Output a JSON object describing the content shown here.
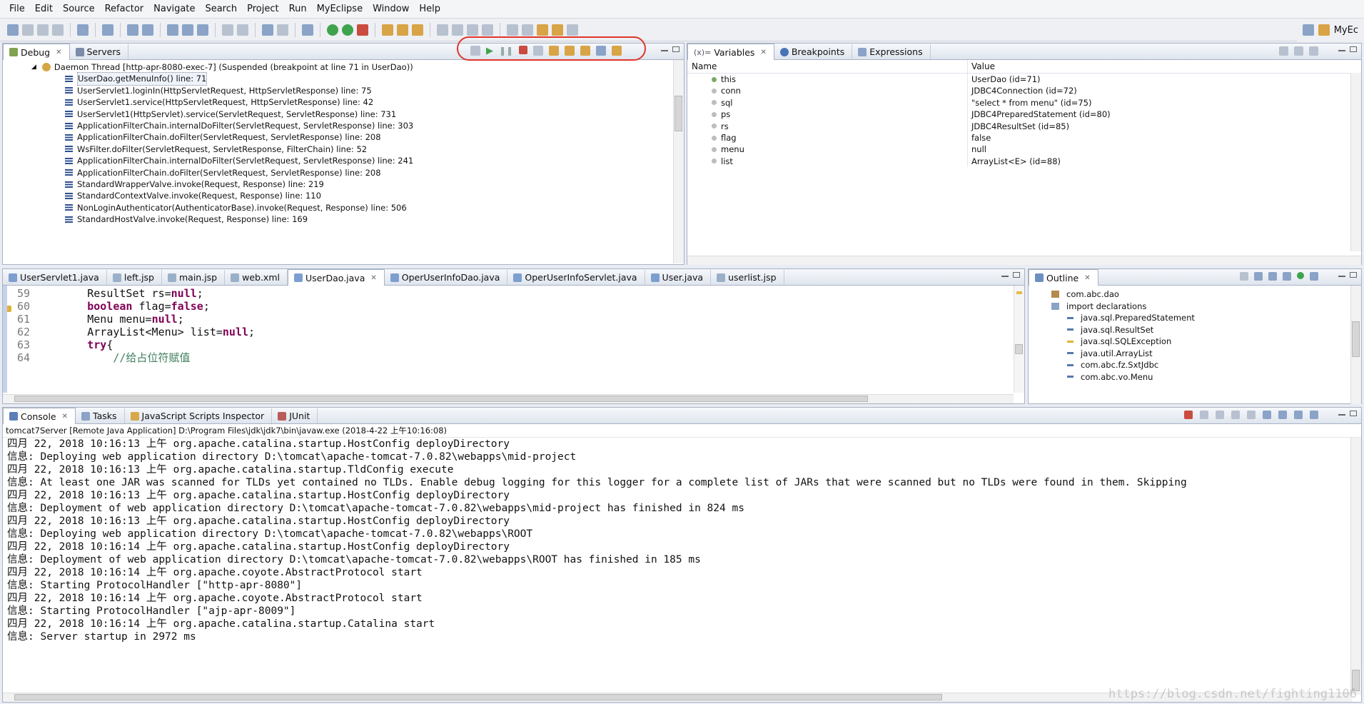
{
  "menubar": {
    "items": [
      "File",
      "Edit",
      "Source",
      "Refactor",
      "Navigate",
      "Search",
      "Project",
      "Run",
      "MyEclipse",
      "Window",
      "Help"
    ]
  },
  "perspective": {
    "label": "MyEc"
  },
  "debug_panel": {
    "tabs": [
      {
        "label": "Debug",
        "icon": "debug-bug-icon",
        "active": true
      },
      {
        "label": "Servers",
        "icon": "servers-icon",
        "active": false
      }
    ],
    "thread": "Daemon Thread [http-apr-8080-exec-7] (Suspended (breakpoint at line 71 in UserDao))",
    "frames": [
      "UserDao.getMenuInfo() line: 71",
      "UserServlet1.loginIn(HttpServletRequest, HttpServletResponse) line: 75",
      "UserServlet1.service(HttpServletRequest, HttpServletResponse) line: 42",
      "UserServlet1(HttpServlet).service(ServletRequest, ServletResponse) line: 731",
      "ApplicationFilterChain.internalDoFilter(ServletRequest, ServletResponse) line: 303",
      "ApplicationFilterChain.doFilter(ServletRequest, ServletResponse) line: 208",
      "WsFilter.doFilter(ServletRequest, ServletResponse, FilterChain) line: 52",
      "ApplicationFilterChain.internalDoFilter(ServletRequest, ServletResponse) line: 241",
      "ApplicationFilterChain.doFilter(ServletRequest, ServletResponse) line: 208",
      "StandardWrapperValve.invoke(Request, Response) line: 219",
      "StandardContextValve.invoke(Request, Response) line: 110",
      "NonLoginAuthenticator(AuthenticatorBase).invoke(Request, Response) line: 506",
      "StandardHostValve.invoke(Request, Response) line: 169"
    ]
  },
  "variables_panel": {
    "tabs": [
      {
        "label": "Variables",
        "active": true
      },
      {
        "label": "Breakpoints",
        "active": false
      },
      {
        "label": "Expressions",
        "active": false
      }
    ],
    "columns": [
      "Name",
      "Value"
    ],
    "rows": [
      {
        "name": "this",
        "value": "UserDao  (id=71)",
        "kind": "local"
      },
      {
        "name": "conn",
        "value": "JDBC4Connection  (id=72)",
        "kind": "field"
      },
      {
        "name": "sql",
        "value": "\"select * from menu\" (id=75)",
        "kind": "field"
      },
      {
        "name": "ps",
        "value": "JDBC4PreparedStatement  (id=80)",
        "kind": "field"
      },
      {
        "name": "rs",
        "value": "JDBC4ResultSet  (id=85)",
        "kind": "field"
      },
      {
        "name": "flag",
        "value": "false",
        "kind": "field"
      },
      {
        "name": "menu",
        "value": "null",
        "kind": "field"
      },
      {
        "name": "list",
        "value": "ArrayList<E>  (id=88)",
        "kind": "field"
      }
    ]
  },
  "editor": {
    "tabs": [
      "UserServlet1.java",
      "left.jsp",
      "main.jsp",
      "web.xml",
      "UserDao.java",
      "OperUserInfoDao.java",
      "OperUserInfoServlet.java",
      "User.java",
      "userlist.jsp"
    ],
    "active_tab": "UserDao.java",
    "lines": [
      {
        "num": "59",
        "pre": "        ResultSet rs=",
        "kw": "null",
        "post": ";"
      },
      {
        "num": "60",
        "pre": "        ",
        "kw": "boolean",
        "post": " flag=",
        "kw2": "false",
        "post2": ";"
      },
      {
        "num": "61",
        "pre": "        Menu menu=",
        "kw": "null",
        "post": ";"
      },
      {
        "num": "62",
        "pre": "        ArrayList<Menu> list=",
        "kw": "null",
        "post": ";"
      },
      {
        "num": "63",
        "pre": "        ",
        "kw": "try",
        "post": "{"
      },
      {
        "num": "64",
        "pre": "            ",
        "comment": "//给占位符赋值"
      }
    ]
  },
  "outline_panel": {
    "tab": "Outline",
    "items": [
      {
        "label": "com.abc.dao",
        "indent": 0,
        "icon": "package-icon"
      },
      {
        "label": "import declarations",
        "indent": 0,
        "icon": "imports-icon"
      },
      {
        "label": "java.sql.PreparedStatement",
        "indent": 1,
        "icon": "import-icon"
      },
      {
        "label": "java.sql.ResultSet",
        "indent": 1,
        "icon": "import-icon"
      },
      {
        "label": "java.sql.SQLException",
        "indent": 1,
        "icon": "import-warning-icon"
      },
      {
        "label": "java.util.ArrayList",
        "indent": 1,
        "icon": "import-icon"
      },
      {
        "label": "com.abc.fz.SxtJdbc",
        "indent": 1,
        "icon": "import-icon"
      },
      {
        "label": "com.abc.vo.Menu",
        "indent": 1,
        "icon": "import-icon"
      }
    ]
  },
  "console_panel": {
    "tabs": [
      {
        "label": "Console",
        "active": true
      },
      {
        "label": "Tasks",
        "active": false
      },
      {
        "label": "JavaScript Scripts Inspector",
        "active": false
      },
      {
        "label": "JUnit",
        "active": false
      }
    ],
    "process": "tomcat7Server [Remote Java Application] D:\\Program Files\\jdk\\jdk7\\bin\\javaw.exe (2018-4-22 上午10:16:08)",
    "lines": [
      "四月 22, 2018 10:16:13 上午 org.apache.catalina.startup.HostConfig deployDirectory",
      "信息: Deploying web application directory D:\\tomcat\\apache-tomcat-7.0.82\\webapps\\mid-project",
      "四月 22, 2018 10:16:13 上午 org.apache.catalina.startup.TldConfig execute",
      "信息: At least one JAR was scanned for TLDs yet contained no TLDs. Enable debug logging for this logger for a complete list of JARs that were scanned but no TLDs were found in them. Skipping",
      "四月 22, 2018 10:16:13 上午 org.apache.catalina.startup.HostConfig deployDirectory",
      "信息: Deployment of web application directory D:\\tomcat\\apache-tomcat-7.0.82\\webapps\\mid-project has finished in 824 ms",
      "四月 22, 2018 10:16:13 上午 org.apache.catalina.startup.HostConfig deployDirectory",
      "信息: Deploying web application directory D:\\tomcat\\apache-tomcat-7.0.82\\webapps\\ROOT",
      "四月 22, 2018 10:16:14 上午 org.apache.catalina.startup.HostConfig deployDirectory",
      "信息: Deployment of web application directory D:\\tomcat\\apache-tomcat-7.0.82\\webapps\\ROOT has finished in 185 ms",
      "四月 22, 2018 10:16:14 上午 org.apache.coyote.AbstractProtocol start",
      "信息: Starting ProtocolHandler [\"http-apr-8080\"]",
      "四月 22, 2018 10:16:14 上午 org.apache.coyote.AbstractProtocol start",
      "信息: Starting ProtocolHandler [\"ajp-apr-8009\"]",
      "四月 22, 2018 10:16:14 上午 org.apache.catalina.startup.Catalina start",
      "信息: Server startup in 2972 ms"
    ]
  },
  "watermark": "https://blog.csdn.net/fighting1106",
  "colors": {
    "annotation": "#e2352b",
    "keyword": "#7f0055",
    "comment": "#3f7f5f"
  }
}
